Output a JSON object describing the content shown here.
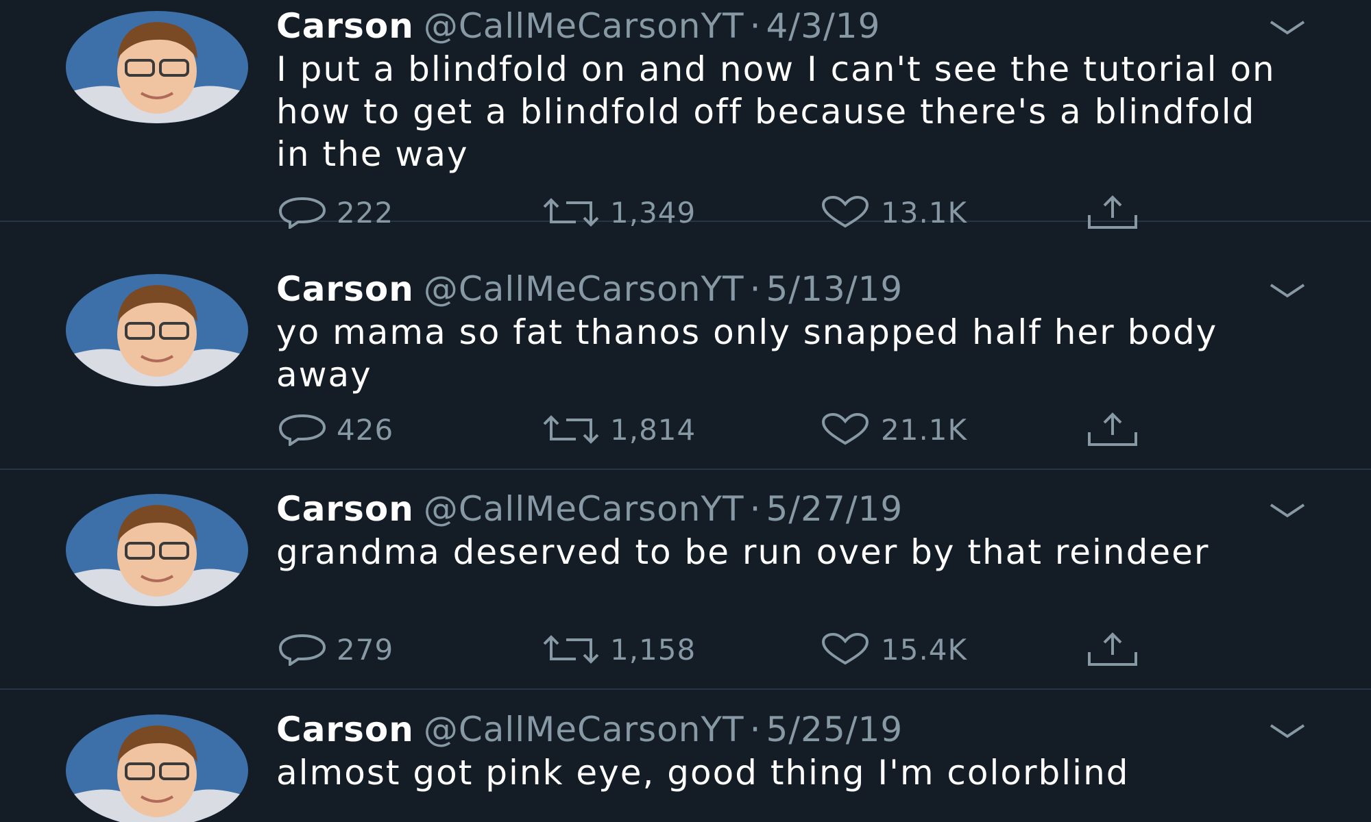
{
  "tweets": [
    {
      "name": "Carson",
      "handle": "@CallMeCarsonYT",
      "separator": "·",
      "date": "4/3/19",
      "text": "I put a blindfold on and now I can't see the tutorial on how to get a blindfold off because there's a blindfold in the way",
      "replies": "222",
      "retweets": "1,349",
      "likes": "13.1K"
    },
    {
      "name": "Carson",
      "handle": "@CallMeCarsonYT",
      "separator": "·",
      "date": "5/13/19",
      "text": "yo mama so fat thanos only snapped half her body away",
      "replies": "426",
      "retweets": "1,814",
      "likes": "21.1K"
    },
    {
      "name": "Carson",
      "handle": "@CallMeCarsonYT",
      "separator": "·",
      "date": "5/27/19",
      "text": "grandma deserved to be run over by that reindeer",
      "replies": "279",
      "retweets": "1,158",
      "likes": "15.4K"
    },
    {
      "name": "Carson",
      "handle": "@CallMeCarsonYT",
      "separator": "·",
      "date": "5/25/19",
      "text": "almost got pink eye, good thing I'm colorblind",
      "replies": "",
      "retweets": "",
      "likes": ""
    }
  ],
  "colors": {
    "background": "#141d26",
    "secondary_text": "#8899a6",
    "divider": "#263445"
  },
  "icons": [
    "reply-icon",
    "retweet-icon",
    "like-icon",
    "share-icon",
    "caret-down-icon"
  ]
}
